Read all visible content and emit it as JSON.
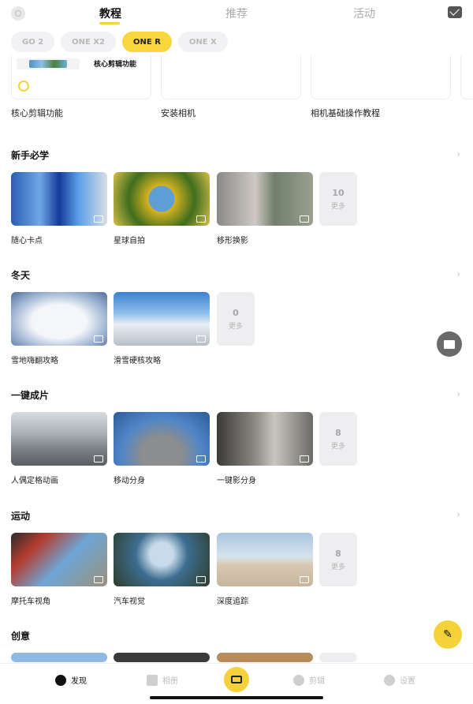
{
  "top_tabs": [
    "教程",
    "推荐",
    "活动"
  ],
  "chips": [
    "GO 2",
    "ONE X2",
    "ONE R",
    "ONE X"
  ],
  "featured": {
    "card_title": "核心剪辑功能",
    "labels": [
      "核心剪辑功能",
      "安装相机",
      "相机基础操作教程"
    ]
  },
  "sections": [
    {
      "title": "新手必学",
      "items": [
        "随心卡点",
        "星球自拍",
        "移形换影"
      ],
      "more_count": "10",
      "more_label": "更多"
    },
    {
      "title": "冬天",
      "items": [
        "雪地嗨翻攻略",
        "滑雪硬核攻略"
      ],
      "more_count": "0",
      "more_label": "更多"
    },
    {
      "title": "一键成片",
      "items": [
        "人偶定格动画",
        "移动分身",
        "一键影分身"
      ],
      "more_count": "8",
      "more_label": "更多"
    },
    {
      "title": "运动",
      "items": [
        "摩托车视角",
        "汽车视觉",
        "深度追踪"
      ],
      "more_count": "8",
      "more_label": "更多"
    },
    {
      "title": "创意",
      "items": []
    }
  ],
  "bottom_nav": [
    "发现",
    "相册",
    "剪辑",
    "设置"
  ],
  "colors": {
    "accent": "#f6d23a"
  },
  "icons": [
    "mail-icon",
    "book-icon",
    "pen-icon",
    "camera-icon"
  ]
}
